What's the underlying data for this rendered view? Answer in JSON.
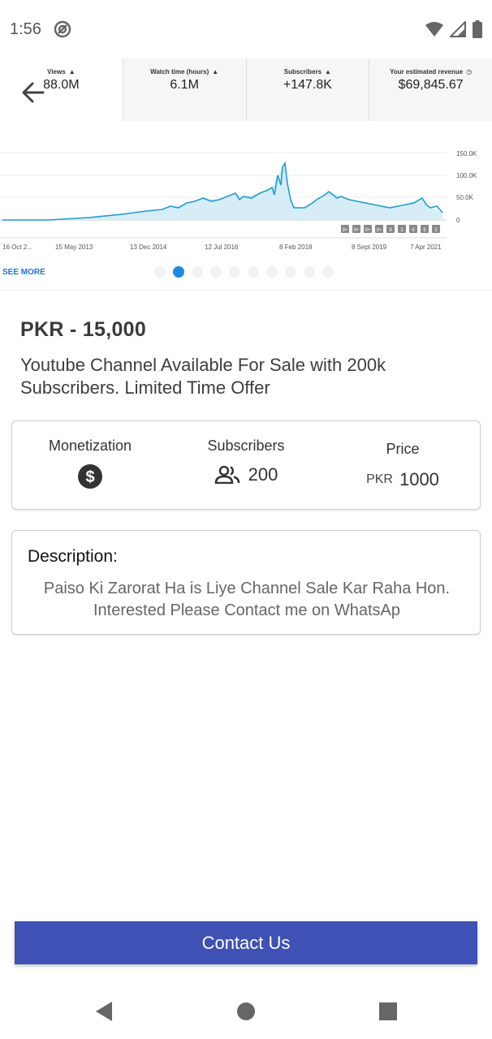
{
  "status_bar": {
    "time": "1:56"
  },
  "hero": {
    "metrics": [
      {
        "label": "Views",
        "value": "88.0M"
      },
      {
        "label": "Watch time (hours)",
        "value": "6.1M"
      },
      {
        "label": "Subscribers",
        "value": "+147.8K"
      },
      {
        "label": "Your estimated revenue",
        "value": "$69,845.67"
      }
    ],
    "chart": {
      "y_ticks": [
        "150.0K",
        "100.0K",
        "50.0K",
        "0"
      ],
      "x_ticks": [
        "16 Oct 2...",
        "15 May 2013",
        "13 Dec 2014",
        "12 Jul 2016",
        "8 Feb 2018",
        "8 Sept 2019",
        "7 Apr 2021"
      ],
      "markers": [
        "9+",
        "9+",
        "9+",
        "9+",
        "9",
        "3",
        "8",
        "6",
        "2"
      ]
    },
    "see_more": "SEE MORE",
    "page_dots": 10,
    "active_dot": 1
  },
  "listing": {
    "price": "PKR - 15,000",
    "title": "Youtube Channel Available For Sale with 200k Subscribers. Limited Time Offer"
  },
  "info_card": {
    "monetization_label": "Monetization",
    "subscribers_label": "Subscribers",
    "subscribers_value": "200",
    "price_label": "Price",
    "price_currency": "PKR",
    "price_value": "1000"
  },
  "description": {
    "heading": "Description:",
    "body": "Paiso Ki Zarorat Ha is Liye Channel Sale Kar Raha Hon. Interested Please Contact me on WhatsAp"
  },
  "contact_button": "Contact Us",
  "colors": {
    "accent": "#3f51b5",
    "chart_line": "#1f9bd1",
    "dot_active": "#1e88e5"
  }
}
